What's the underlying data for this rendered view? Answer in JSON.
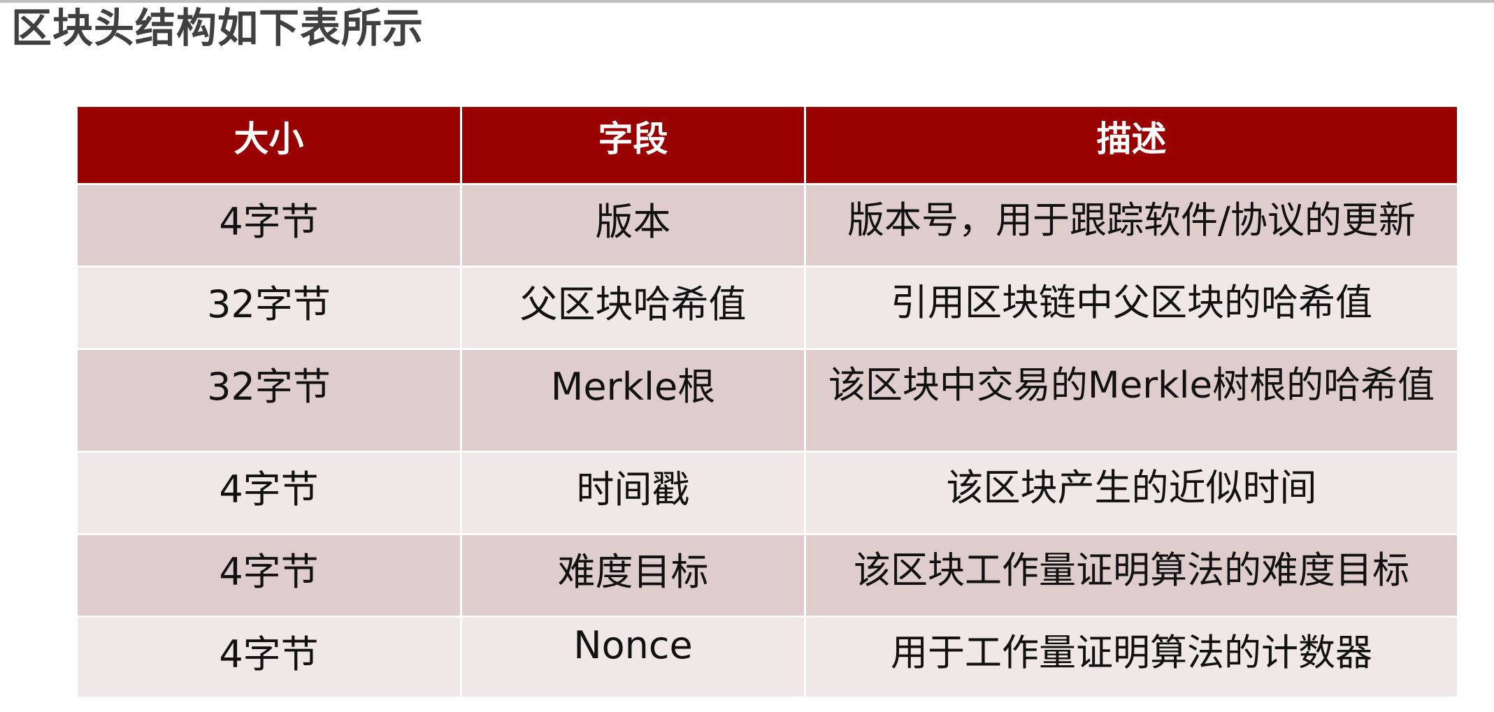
{
  "title": "区块头结构如下表所示",
  "table": {
    "headers": [
      "大小",
      "字段",
      "描述"
    ],
    "rows": [
      [
        "4字节",
        "版本",
        "版本号，用于跟踪软件/协议的更新"
      ],
      [
        "32字节",
        "父区块哈希值",
        "引用区块链中父区块的哈希值"
      ],
      [
        "32字节",
        "Merkle根",
        "该区块中交易的Merkle树根的哈希值"
      ],
      [
        "4字节",
        "时间戳",
        "该区块产生的近似时间"
      ],
      [
        "4字节",
        "难度目标",
        "该区块工作量证明算法的难度目标"
      ],
      [
        "4字节",
        "Nonce",
        "用于工作量证明算法的计数器"
      ]
    ]
  },
  "colors": {
    "header_bg": "#990000",
    "row_dark": "#dfcdce",
    "row_light": "#efe7e8",
    "title_text": "#404040"
  }
}
